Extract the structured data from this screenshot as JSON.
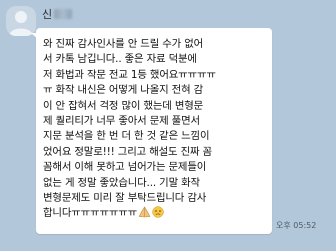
{
  "chat": {
    "sender_name": "신",
    "time": "오후 05:52",
    "message_lines": [
      "와 진짜 감사인사를 안 드릴 수가 없어",
      "서 카톡 남깁니다.. 좋은 자료 덕분에",
      "저 화법과 작문 전교 1등 했어요ㅠㅠㅠㅠ",
      "ㅠ 화작 내신은 어떻게 나올지 전혀 감",
      "이 안 잡혀서 걱정 많이 했는데 변형문",
      "제 퀄리티가 너무 좋아서 문제 풀면서",
      "지문 분석을 한 번 더 한 것 같은 느낌이",
      "었어요 정말로!!! 그리고 해설도 진짜 꼼",
      "꼼해서 이해 못하고 넘어가는 문제들이",
      "없는 게 정말 좋았습니다... 기말 화작",
      "변형문제도 미리 잘 부탁드립니다 감사",
      "합니다ㅠㅠㅠㅠㅠㅠㅠ"
    ],
    "emojis": [
      "folded-hands-emoji",
      "worried-face-emoji"
    ]
  }
}
